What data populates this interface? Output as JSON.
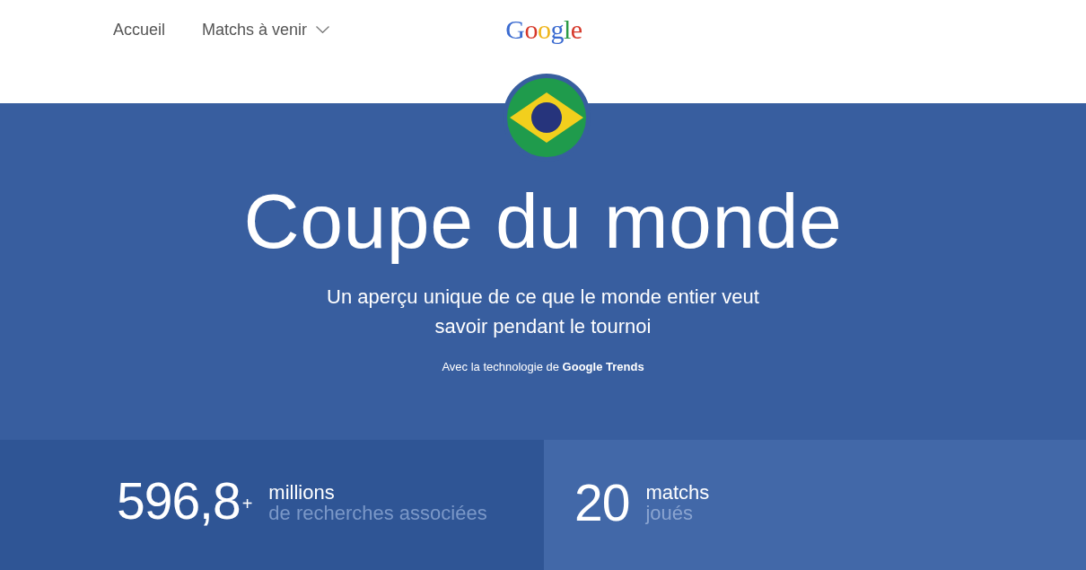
{
  "header": {
    "nav": [
      {
        "label": "Accueil",
        "kind": "link"
      },
      {
        "label": "Matchs à venir",
        "kind": "dropdown"
      }
    ],
    "logo": "Google"
  },
  "hero": {
    "title": "Coupe du monde",
    "subtitle": "Un aperçu unique de ce que le monde entier veut savoir pendant le tournoi",
    "credit": "Avec la technologie de **Google Trends**"
  },
  "stats": [
    {
      "value": "596,8$^{+}$",
      "label": "millions",
      "sublabel": "de recherches associées"
    },
    {
      "value": "20",
      "label": "matchs",
      "sublabel": "joués"
    }
  ]
}
